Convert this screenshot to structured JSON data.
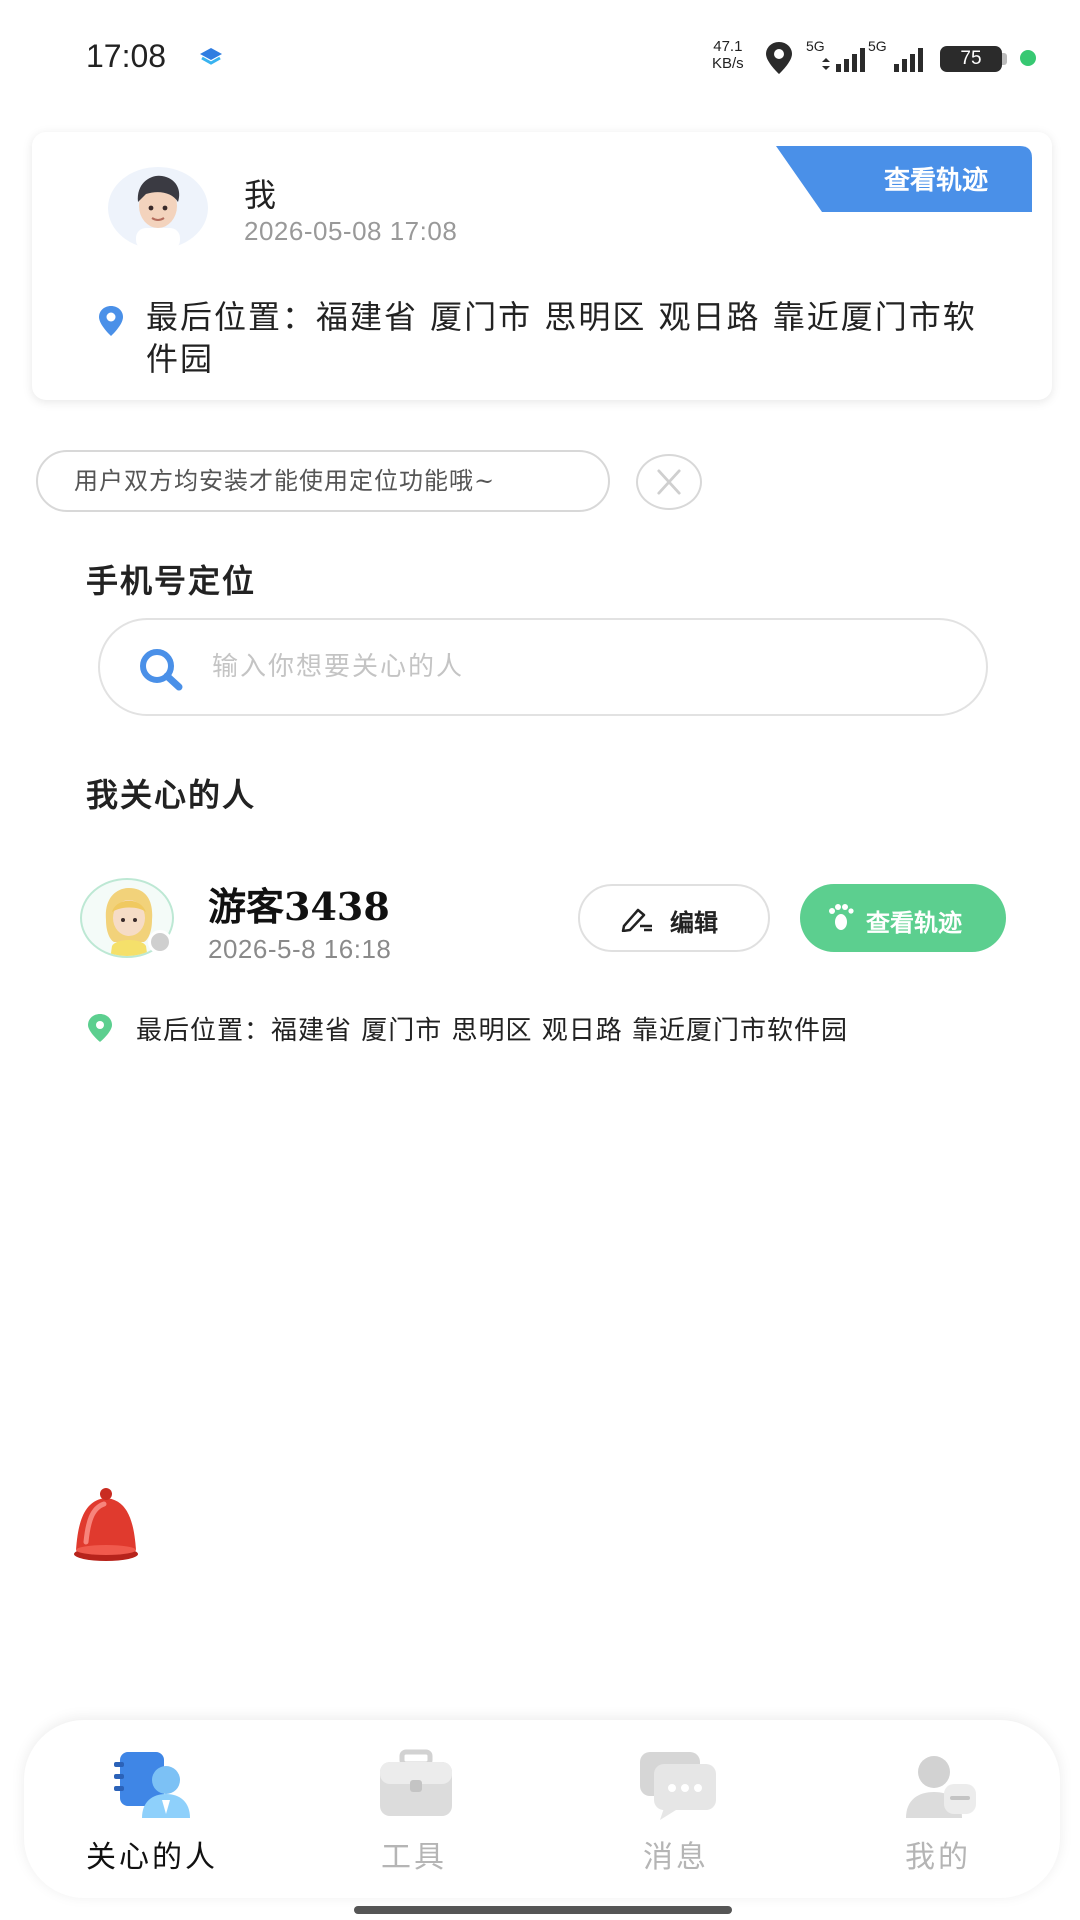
{
  "status_bar": {
    "time": "17:08",
    "net_speed_value": "47.1",
    "net_speed_unit": "KB/s",
    "sim1_label": "5G",
    "sim2_label": "5G",
    "battery": "75"
  },
  "me_card": {
    "name": "我",
    "time": "2026-05-08 17:08",
    "location": "最后位置：福建省 厦门市 思明区 观日路 靠近厦门市软件园",
    "track_button": "查看轨迹"
  },
  "notice": {
    "text": "用户双方均安装才能使用定位功能哦~"
  },
  "phone_locate": {
    "title": "手机号定位",
    "search_placeholder": "输入你想要关心的人"
  },
  "care_list": {
    "title": "我关心的人",
    "items": [
      {
        "name": "游客3438",
        "time": "2026-5-8 16:18",
        "edit_label": "编辑",
        "track_label": "查看轨迹",
        "location": "最后位置：福建省 厦门市 思明区 观日路 靠近厦门市软件园"
      }
    ]
  },
  "tabbar": {
    "tabs": [
      {
        "label": "关心的人",
        "active": true,
        "icon": "people-care-icon"
      },
      {
        "label": "工具",
        "active": false,
        "icon": "toolbox-icon"
      },
      {
        "label": "消息",
        "active": false,
        "icon": "message-icon"
      },
      {
        "label": "我的",
        "active": false,
        "icon": "user-icon"
      }
    ]
  },
  "colors": {
    "accent_blue": "#4a90e8",
    "accent_green": "#5ccf8f",
    "bell_red": "#e03a2e"
  }
}
